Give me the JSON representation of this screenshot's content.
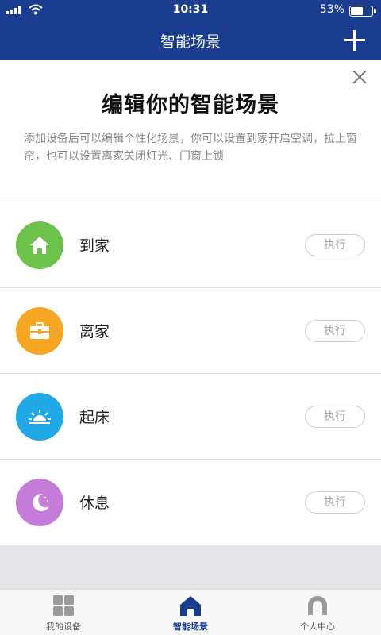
{
  "status_bar": {
    "time": "10:31",
    "battery": "53%",
    "battery_level": 0.53
  },
  "nav": {
    "title": "智能场景"
  },
  "banner": {
    "heading": "编辑你的智能场景",
    "description": "添加设备后可以编辑个性化场景，你可以设置到家开启空调，拉上窗帘，也可以设置离家关闭灯光、门窗上锁"
  },
  "scenes": [
    {
      "name": "到家",
      "action": "执行",
      "icon": "home-icon",
      "color": "#6cc24a"
    },
    {
      "name": "离家",
      "action": "执行",
      "icon": "briefcase-icon",
      "color": "#f5a623"
    },
    {
      "name": "起床",
      "action": "执行",
      "icon": "sunrise-icon",
      "color": "#1fa9e6"
    },
    {
      "name": "休息",
      "action": "执行",
      "icon": "moon-icon",
      "color": "#c57bd8"
    }
  ],
  "tabs": [
    {
      "label": "我的设备",
      "icon": "grid-icon",
      "active": false
    },
    {
      "label": "智能场景",
      "icon": "home-icon",
      "active": true
    },
    {
      "label": "个人中心",
      "icon": "user-icon",
      "active": false
    }
  ],
  "colors": {
    "brand": "#1a3d8f",
    "inactive_icon": "#9a9a9a"
  }
}
